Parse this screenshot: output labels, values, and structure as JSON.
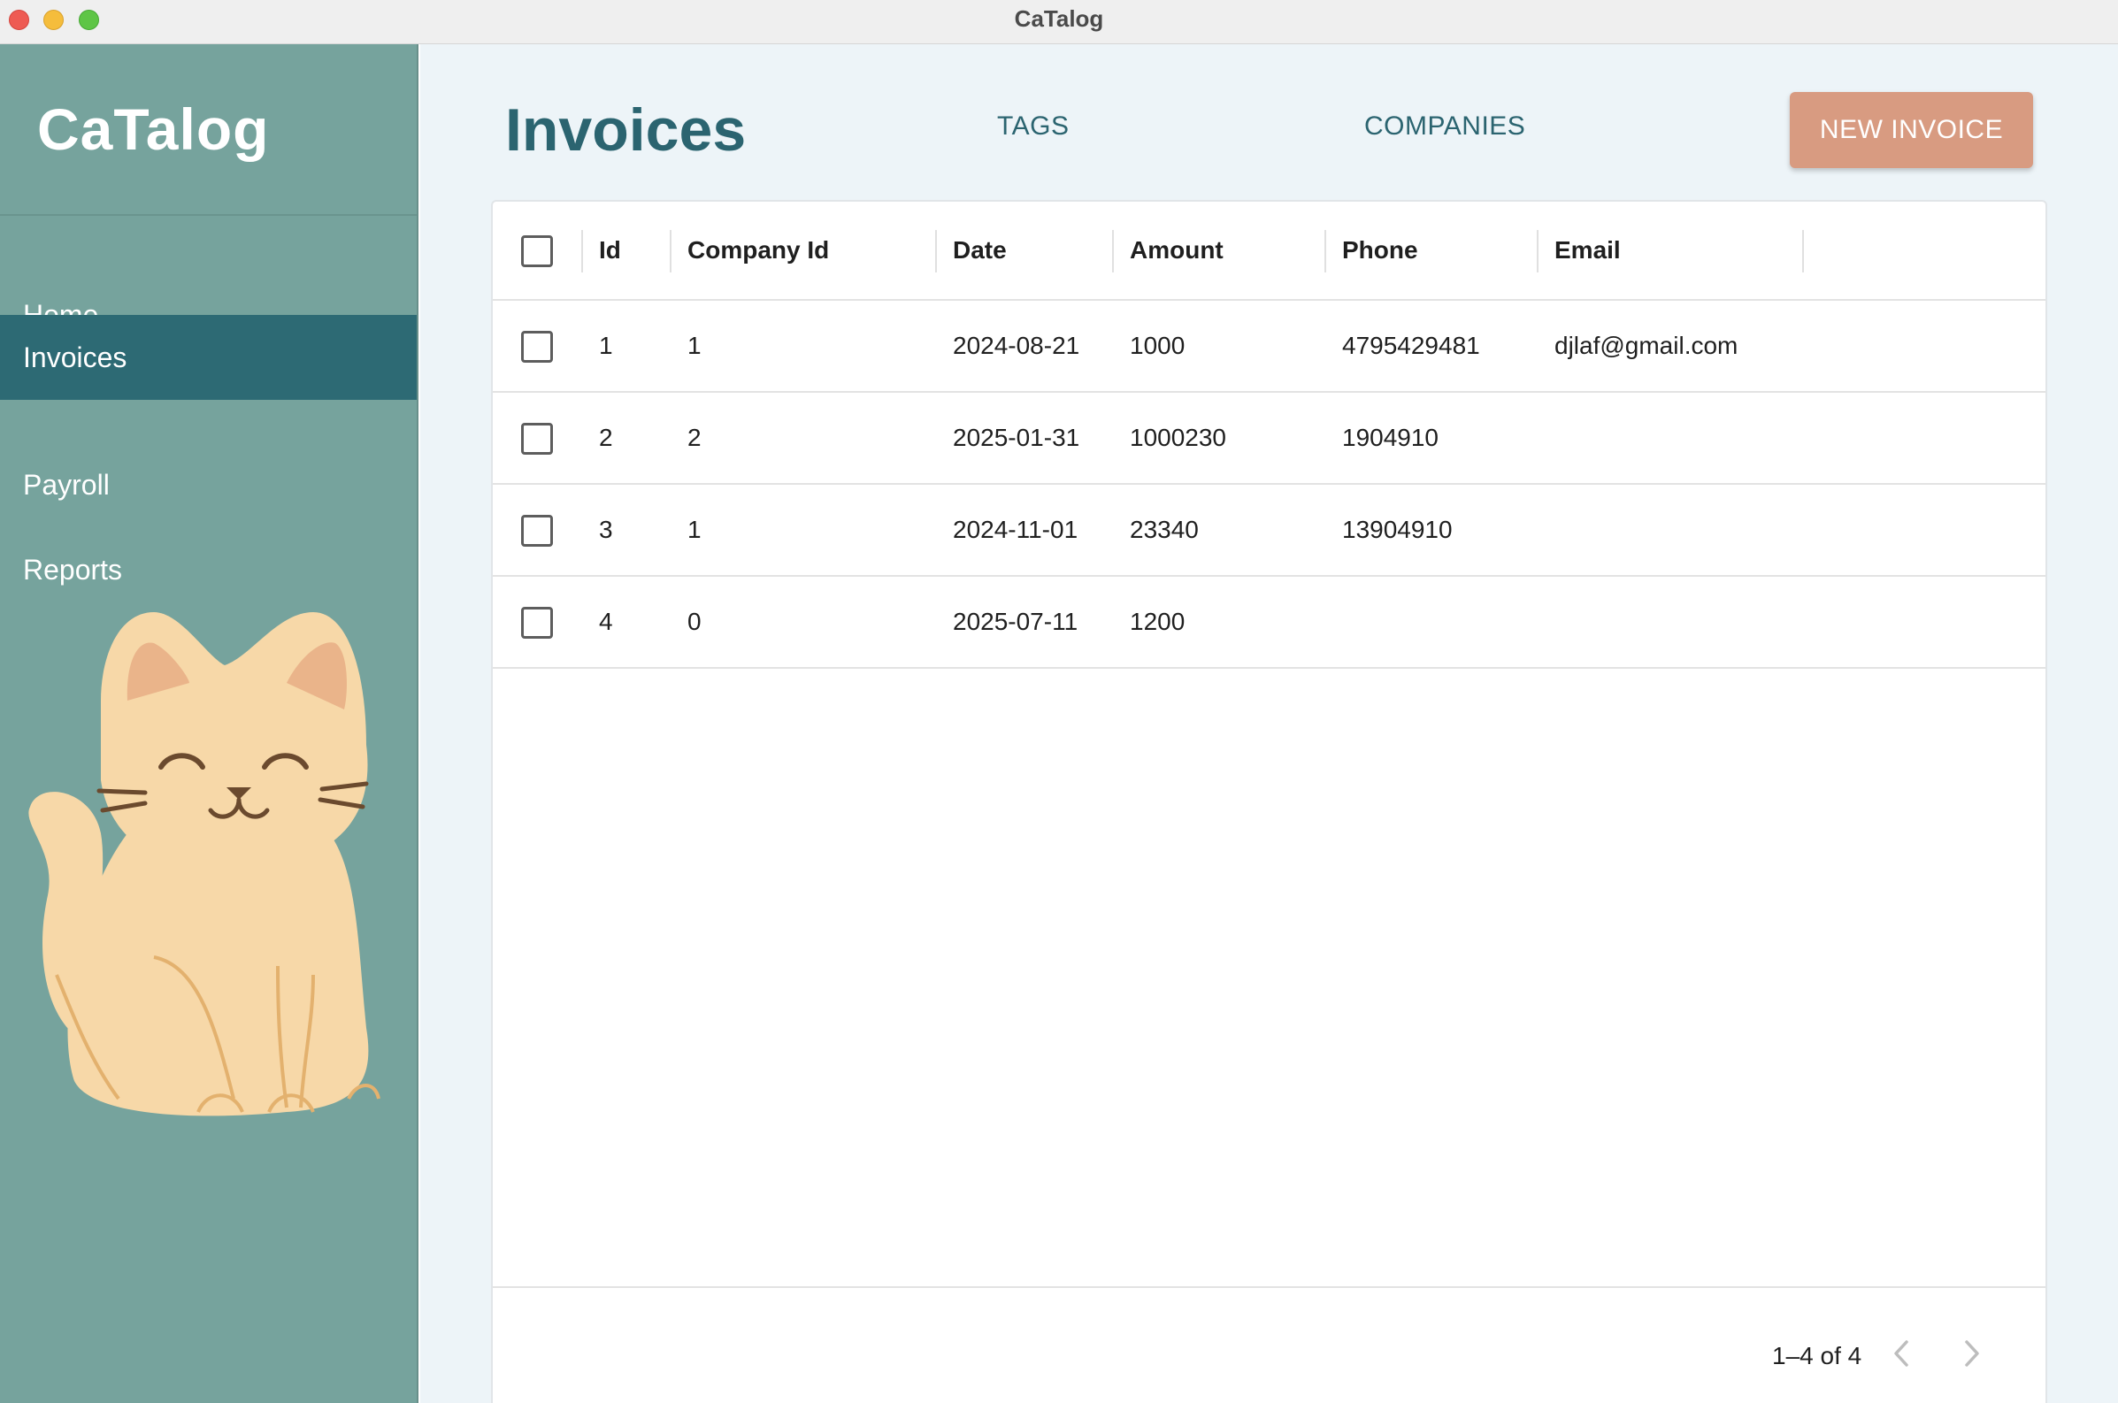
{
  "window": {
    "title": "CaTalog"
  },
  "sidebar": {
    "brand": "CaTalog",
    "items": [
      {
        "label": "Home",
        "active": false
      },
      {
        "label": "Invoices",
        "active": true
      },
      {
        "label": "Payroll",
        "active": false
      },
      {
        "label": "Reports",
        "active": false
      }
    ]
  },
  "header": {
    "title": "Invoices",
    "links": [
      "TAGS",
      "COMPANIES"
    ],
    "new_button": "NEW INVOICE"
  },
  "table": {
    "columns": [
      "Id",
      "Company Id",
      "Date",
      "Amount",
      "Phone",
      "Email"
    ],
    "rows": [
      {
        "id": "1",
        "company_id": "1",
        "date": "2024-08-21",
        "amount": "1000",
        "phone": "4795429481",
        "email": "djlaf@gmail.com"
      },
      {
        "id": "2",
        "company_id": "2",
        "date": "2025-01-31",
        "amount": "1000230",
        "phone": "1904910",
        "email": ""
      },
      {
        "id": "3",
        "company_id": "1",
        "date": "2024-11-01",
        "amount": "23340",
        "phone": "13904910",
        "email": ""
      },
      {
        "id": "4",
        "company_id": "0",
        "date": "2025-07-11",
        "amount": "1200",
        "phone": "",
        "email": ""
      }
    ]
  },
  "pagination": {
    "label": "1–4 of 4"
  },
  "colors": {
    "sidebar": "#76a39d",
    "sidebar_active": "#2d6a74",
    "accent_text": "#2b6470",
    "button": "#d89b81",
    "main_bg": "#edf4f8"
  },
  "icons": [
    "cat-illustration",
    "chevron-left-icon",
    "chevron-right-icon"
  ]
}
